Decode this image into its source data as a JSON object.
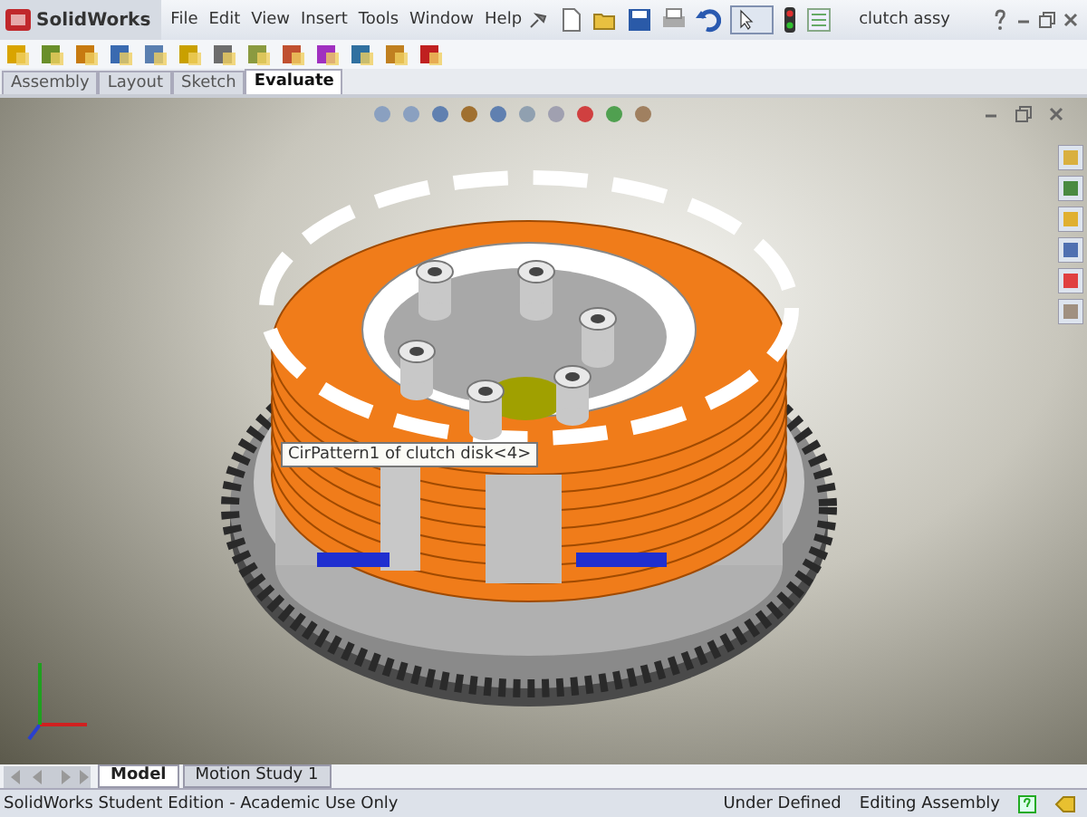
{
  "app": {
    "logo": "SolidWorks"
  },
  "menu": [
    {
      "label": "File"
    },
    {
      "label": "Edit"
    },
    {
      "label": "View"
    },
    {
      "label": "Insert"
    },
    {
      "label": "Tools"
    },
    {
      "label": "Window"
    },
    {
      "label": "Help"
    }
  ],
  "document_title": "clutch assy",
  "command_tabs": [
    {
      "label": "Assembly",
      "selected": false
    },
    {
      "label": "Layout",
      "selected": false
    },
    {
      "label": "Sketch",
      "selected": false
    },
    {
      "label": "Evaluate",
      "selected": true
    }
  ],
  "tooltip": "CirPattern1 of clutch disk<4>",
  "bottom_tabs": [
    {
      "label": "Model",
      "selected": true
    },
    {
      "label": "Motion Study 1",
      "selected": false
    }
  ],
  "status_bar": {
    "edition": "SolidWorks Student Edition - Academic Use Only",
    "state": "Under Defined",
    "mode": "Editing Assembly"
  }
}
